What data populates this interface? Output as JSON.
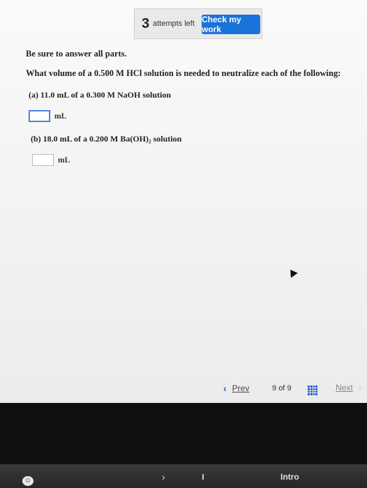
{
  "header": {
    "attempts_count": "3",
    "attempts_label": "attempts left",
    "check_button_label": "Check my work"
  },
  "content": {
    "instructions": "Be sure to answer all parts.",
    "question": "What volume of a 0.500 M HCl solution is needed to neutralize each of the following:",
    "part_a": {
      "label": "(a) 11.0 mL of a 0.300 M NaOH solution",
      "value": "",
      "unit": "mL"
    },
    "part_b": {
      "label": "(b) 18.0 mL of a 0.200 M Ba(OH)₂ solution",
      "value": "",
      "unit": "mL"
    }
  },
  "navigation": {
    "prev_label": "Prev",
    "page_current": "9",
    "page_of": "of",
    "page_total": "9",
    "next_label": "Next"
  },
  "taskbar": {
    "tab_marker": "1",
    "intro_label": "Intro"
  }
}
